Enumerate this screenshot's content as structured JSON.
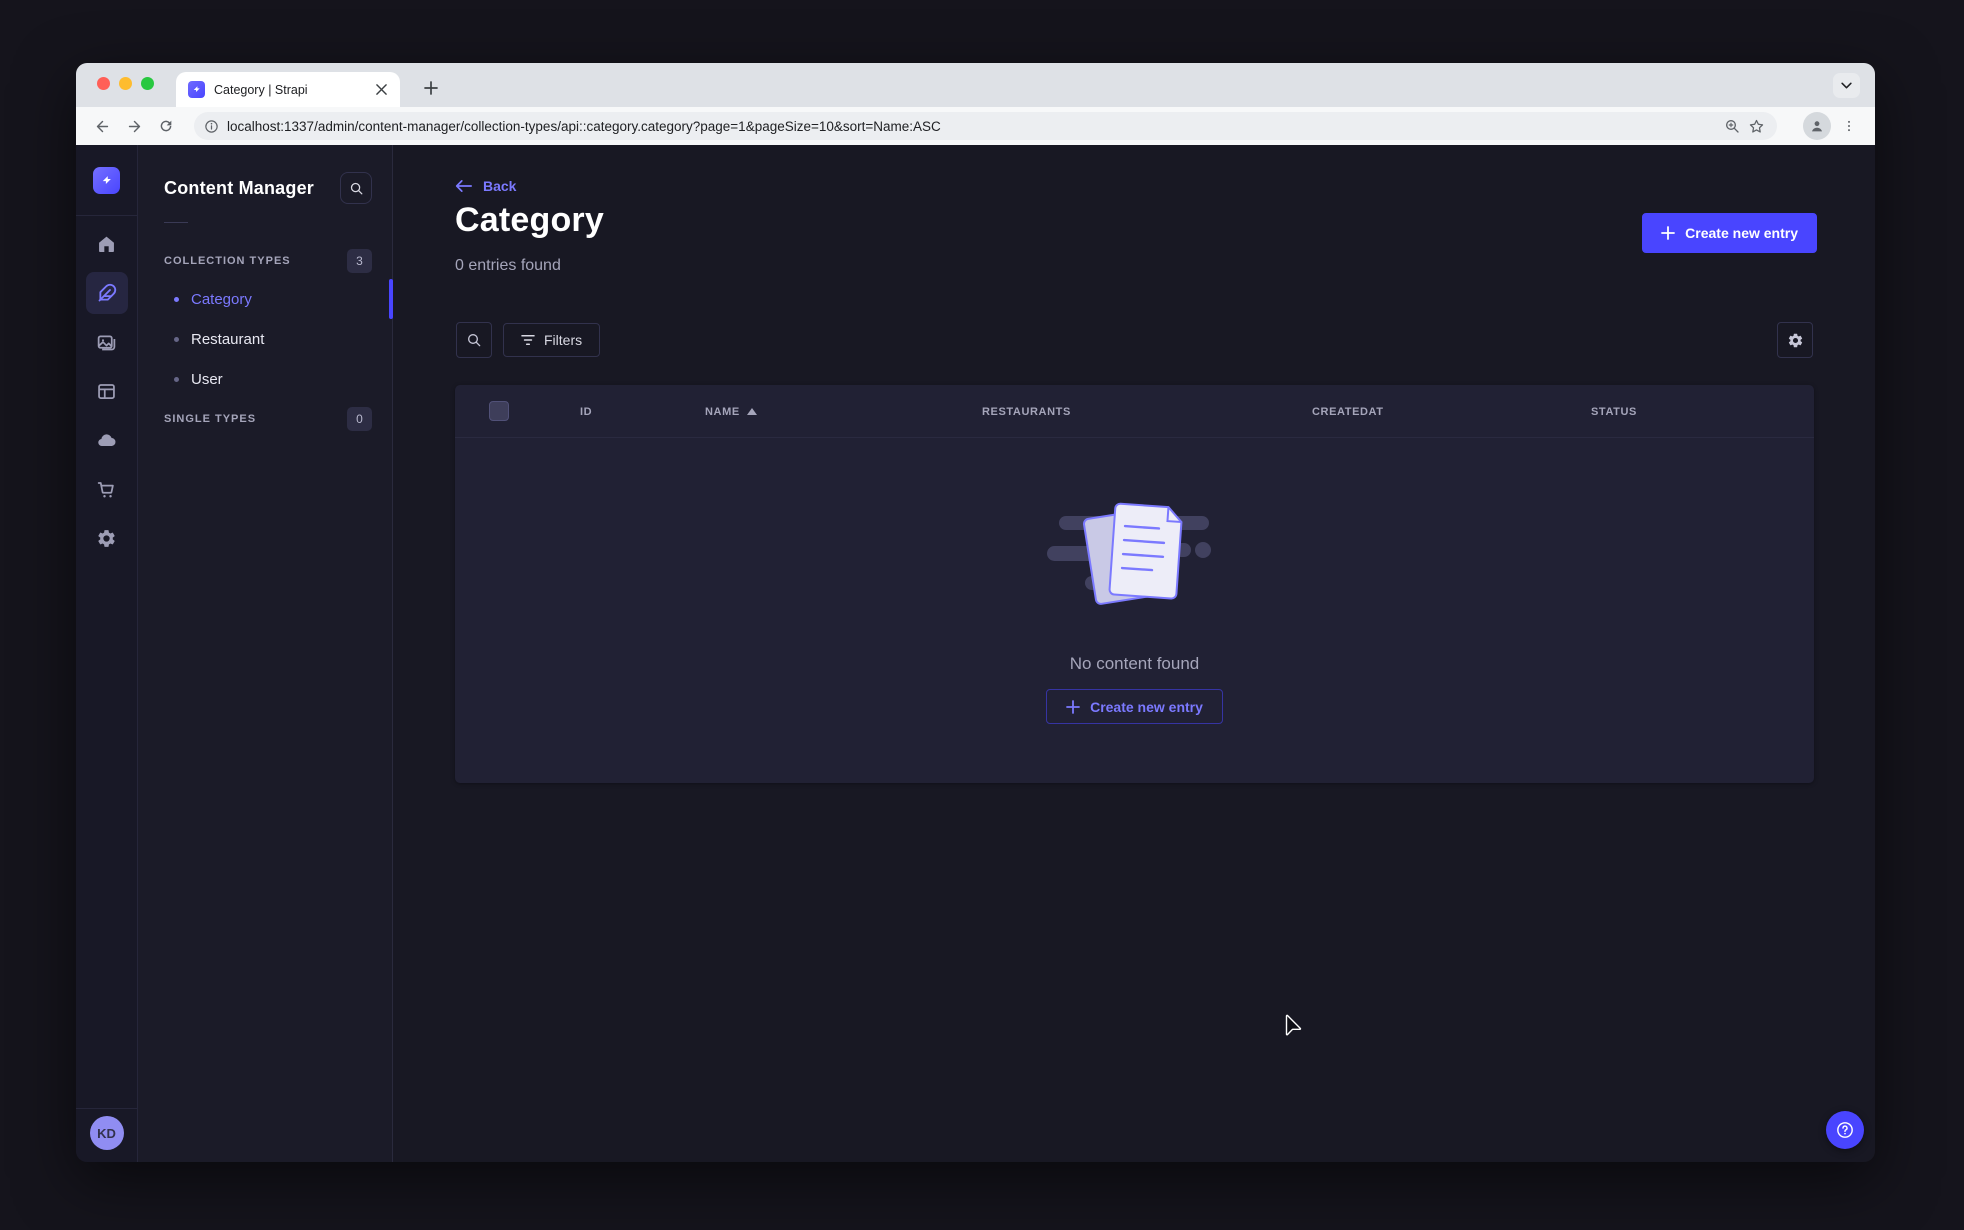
{
  "colors": {
    "primary": "#4945ff",
    "link": "#7b79ff",
    "app_background": "#181823",
    "card_background": "#212134",
    "muted_text": "#a5a5ba"
  },
  "browser": {
    "tab_title": "Category | Strapi",
    "url": "localhost:1337/admin/content-manager/collection-types/api::category.category?page=1&pageSize=10&sort=Name:ASC",
    "toolbar_icons": [
      "back-icon",
      "forward-icon",
      "reload-icon",
      "page-info-icon",
      "zoom-icon",
      "bookmark-star-icon",
      "profile-icon",
      "kebab-menu-icon"
    ],
    "tabstrip_icons": [
      "close-tab-icon",
      "new-tab-icon",
      "tab-search-chevron-icon"
    ]
  },
  "rail": {
    "logo": "strapi-logo",
    "items": [
      {
        "name": "home-icon",
        "active": false
      },
      {
        "name": "content-manager-icon",
        "active": true
      },
      {
        "name": "media-library-icon",
        "active": false
      },
      {
        "name": "content-type-builder-icon",
        "active": false
      },
      {
        "name": "cloud-icon",
        "active": false
      },
      {
        "name": "marketplace-icon",
        "active": false
      },
      {
        "name": "settings-icon",
        "active": false
      }
    ],
    "user_initials": "KD"
  },
  "subnav": {
    "title": "Content Manager",
    "search_icon": "search-icon",
    "sections": [
      {
        "label": "COLLECTION TYPES",
        "badge": "3",
        "items": [
          {
            "label": "Category",
            "active": true
          },
          {
            "label": "Restaurant",
            "active": false
          },
          {
            "label": "User",
            "active": false
          }
        ]
      },
      {
        "label": "SINGLE TYPES",
        "badge": "0",
        "items": []
      }
    ]
  },
  "header": {
    "back_label": "Back",
    "title": "Category",
    "subtitle": "0 entries found",
    "create_button_label": "Create new entry"
  },
  "list_toolbar": {
    "search_icon": "search-icon",
    "filters_label": "Filters",
    "settings_icon": "gear-icon"
  },
  "table": {
    "columns": [
      "ID",
      "NAME",
      "RESTAURANTS",
      "CREATEDAT",
      "STATUS"
    ],
    "sorted_column": "NAME",
    "sort_direction": "ascending",
    "rows": []
  },
  "empty_state": {
    "message": "No content found",
    "create_button_label": "Create new entry"
  },
  "fab": {
    "icon_glyph": "?"
  }
}
